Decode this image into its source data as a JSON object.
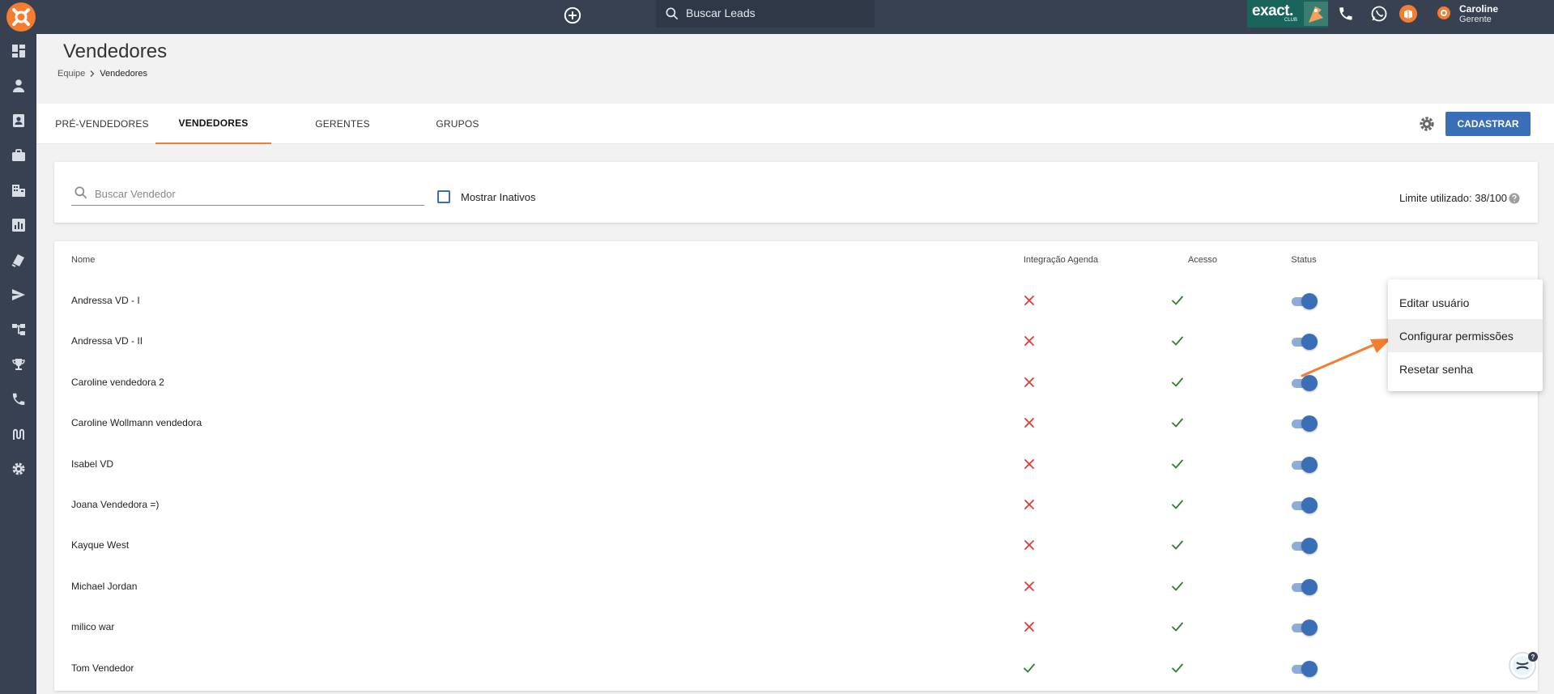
{
  "topbar": {
    "search_placeholder": "Buscar Leads",
    "brand": "exact.",
    "brand_sub": "CLUB",
    "user_name": "Caroline",
    "user_role": "Gerente",
    "icons": [
      "add-circle-icon",
      "search-icon",
      "phone-icon",
      "whatsapp-icon",
      "book-icon",
      "avatar-icon"
    ]
  },
  "sidebar": {
    "icons": [
      "dashboard-icon",
      "person-icon",
      "contact-card-icon",
      "briefcase-icon",
      "building-icon",
      "bar-chart-icon",
      "tag-icon",
      "send-icon",
      "hierarchy-icon",
      "trophy-icon",
      "phone-icon",
      "route-icon",
      "settings-icon"
    ]
  },
  "header": {
    "title": "Vendedores",
    "breadcrumb": [
      "Equipe",
      "Vendedores"
    ]
  },
  "tabs": [
    {
      "label": "PRÉ-VENDEDORES",
      "active": false
    },
    {
      "label": "VENDEDORES",
      "active": true
    },
    {
      "label": "GERENTES",
      "active": false
    },
    {
      "label": "GRUPOS",
      "active": false
    }
  ],
  "actions": {
    "cadastrar_label": "CADASTRAR"
  },
  "filters": {
    "search_placeholder": "Buscar Vendedor",
    "show_inactive_label": "Mostrar Inativos",
    "limit_label": "Limite utilizado: 38/100"
  },
  "table": {
    "headers": [
      "Nome",
      "Integração Agenda",
      "Acesso",
      "Status"
    ],
    "rows": [
      {
        "name": "Andressa VD - I",
        "agenda": false,
        "access": true,
        "status": true
      },
      {
        "name": "Andressa VD - II",
        "agenda": false,
        "access": true,
        "status": true
      },
      {
        "name": "Caroline vendedora 2",
        "agenda": false,
        "access": true,
        "status": true
      },
      {
        "name": "Caroline Wollmann vendedora",
        "agenda": false,
        "access": true,
        "status": true
      },
      {
        "name": "Isabel VD",
        "agenda": false,
        "access": true,
        "status": true
      },
      {
        "name": "Joana Vendedora =)",
        "agenda": false,
        "access": true,
        "status": true
      },
      {
        "name": "Kayque West",
        "agenda": false,
        "access": true,
        "status": true
      },
      {
        "name": "Michael Jordan",
        "agenda": false,
        "access": true,
        "status": true
      },
      {
        "name": "milico war",
        "agenda": false,
        "access": true,
        "status": true
      },
      {
        "name": "Tom Vendedor",
        "agenda": true,
        "access": true,
        "status": true
      }
    ]
  },
  "context_menu": {
    "items": [
      "Editar usuário",
      "Configurar permissões",
      "Resetar senha"
    ],
    "highlighted": "Configurar permissões"
  },
  "colors": {
    "topbar": "#374152",
    "accent": "#3a6eb6",
    "tab_indicator": "#f47d2f",
    "error": "#e53935",
    "success": "#2e7d32",
    "annotation_arrow": "#f47d2f"
  }
}
